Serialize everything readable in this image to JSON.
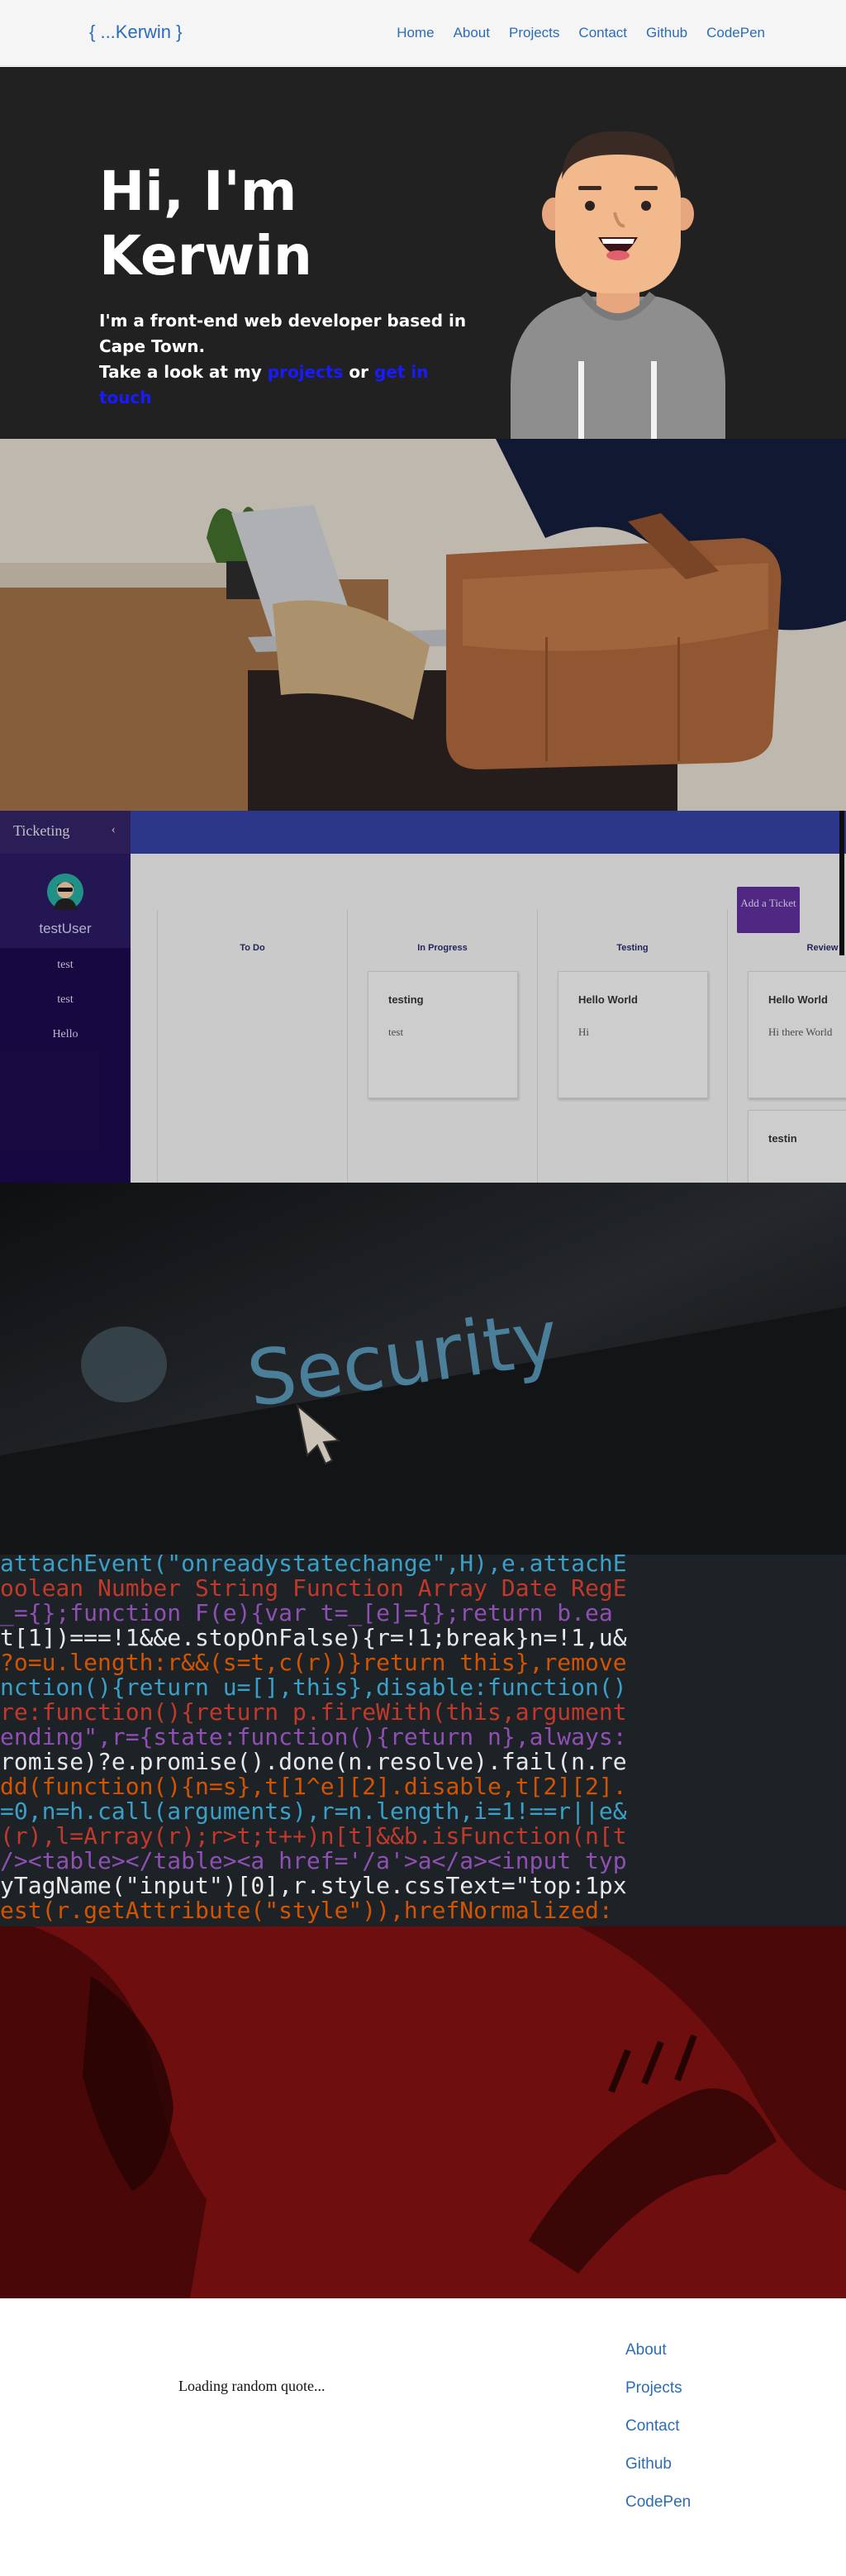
{
  "nav": {
    "logo": "{ ...Kerwin }",
    "links": [
      "Home",
      "About",
      "Projects",
      "Contact",
      "Github",
      "CodePen"
    ]
  },
  "hero": {
    "title": "Hi, I'm Kerwin",
    "line1": "I'm a front-end web developer based in Cape Town.",
    "line2_prefix": "Take a look at my",
    "projects_link": "projects",
    "or": "or",
    "contact_link": "get in touch"
  },
  "ticketing": {
    "app_title": "Ticketing",
    "username": "testUser",
    "sidebar_items": [
      "test",
      "test",
      "Hello"
    ],
    "add_button": "Add a Ticket",
    "columns": [
      {
        "title": "To Do",
        "cards": []
      },
      {
        "title": "In Progress",
        "cards": [
          {
            "title": "testing",
            "desc": "test"
          }
        ]
      },
      {
        "title": "Testing",
        "cards": [
          {
            "title": "Hello World",
            "desc": "Hi"
          }
        ]
      },
      {
        "title": "Review",
        "cards": [
          {
            "title": "Hello World",
            "desc": "Hi there World"
          },
          {
            "title": "testin",
            "desc": ""
          }
        ]
      }
    ]
  },
  "security": {
    "text": "Security"
  },
  "code_lines": [
    "attachEvent(\"onreadystatechange\",H),e.attachE",
    "oolean Number String Function Array Date RegE",
    "_={};function F(e){var t=_[e]={};return b.ea",
    "t[1])===!1&&e.stopOnFalse){r=!1;break}n=!1,u&",
    "?o=u.length:r&&(s=t,c(r))}return this},remove",
    "nction(){return u=[],this},disable:function()",
    "re:function(){return p.fireWith(this,argument",
    "ending\",r={state:function(){return n},always:",
    "romise)?e.promise().done(n.resolve).fail(n.re",
    "dd(function(){n=s},t[1^e][2].disable,t[2][2].",
    "=0,n=h.call(arguments),r=n.length,i=1!==r||e&",
    "(r),l=Array(r);r>t;t++)n[t]&&b.isFunction(n[t",
    "/><table></table><a href='/a'>a</a><input typ",
    "yTagName(\"input\")[0],r.style.cssText=\"top:1px",
    "est(r.getAttribute(\"style\")),hrefNormalized:"
  ],
  "footer": {
    "quote": "Loading random quote...",
    "links": [
      "About",
      "Projects",
      "Contact",
      "Github",
      "CodePen"
    ]
  },
  "colors": {
    "link_blue": "#2a6cb8",
    "hero_bg": "#212121",
    "hero_link": "#1a1aff",
    "ticketing_sidebar": "#1c0a4a",
    "ticketing_topbar": "#333f9e",
    "ticketing_button": "#5d2d97",
    "alien_red": "#7a0d0d"
  }
}
